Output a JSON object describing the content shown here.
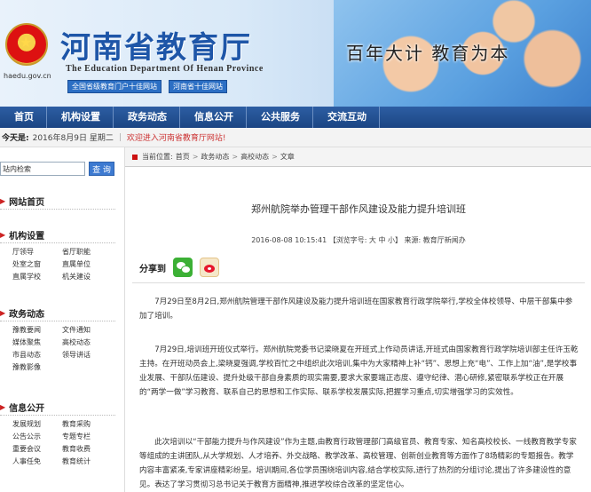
{
  "header": {
    "domain": "haedu.gov.cn",
    "title": "河南省教育厅",
    "title_en": "The Education Department Of Henan Province",
    "badges": [
      "全国省级教育门户十佳网站",
      "河南省十佳网站"
    ],
    "slogan": "百年大计 教育为本"
  },
  "nav": {
    "items": [
      "首页",
      "机构设置",
      "政务动态",
      "信息公开",
      "公共服务",
      "交流互动"
    ]
  },
  "datebar": {
    "label": "今天是:",
    "date": "2016年8月9日 星期二",
    "welcome": "欢迎进入河南省教育厅网站!"
  },
  "sidebar": {
    "search": {
      "value": "站内检索",
      "button": "查 询"
    },
    "sections": [
      {
        "title": "网站首页",
        "items": []
      },
      {
        "title": "机构设置",
        "items": [
          "厅领导",
          "省厅职能",
          "处室之窗",
          "直属单位",
          "直属学校",
          "机关建设"
        ]
      },
      {
        "title": "政务动态",
        "items": [
          "豫教要闻",
          "文件通知",
          "媒体聚焦",
          "高校动态",
          "市县动态",
          "领导讲话",
          "豫教影像"
        ]
      },
      {
        "title": "信息公开",
        "items": [
          "发展规划",
          "教育采购",
          "公告公示",
          "专题专栏",
          "重要会议",
          "教育收费",
          "人事任免",
          "教育统计"
        ]
      }
    ]
  },
  "article": {
    "breadcrumb": [
      "当前位置:",
      "首页",
      "政务动态",
      "高校动态",
      "文章"
    ],
    "title": "郑州航院举办管理干部作风建设及能力提升培训班",
    "meta": "2016-08-08 10:15:41 【浏览字号: 大 中 小】 来源: 教育厅新闻办",
    "share_label": "分享到",
    "paragraphs": [
      "7月29日至8月2日,郑州航院管理干部作风建设及能力提升培训班在国家教育行政学院举行,学校全体校领导、中层干部集中参加了培训。",
      "7月29日,培训班开班仪式举行。郑州航院党委书记梁晓夏在开班式上作动员讲话,开班式由国家教育行政学院培训部主任许玉乾主持。在开班动员会上,梁晓夏强调,学校百忙之中组织此次培训,集中为大家精神上补“钙”、思想上充“电”、工作上加“油”,是学校事业发展、干部队伍建设、提升处级干部自身素质的现实需要,要求大家要端正态度、遵守纪律、潜心研修,紧密联系学校正在开展的“两学一做”学习教育、联系自己的思想和工作实际、联系学校发展实际,把握学习重点,切实增强学习的实效性。",
      "此次培训以“干部能力提升与作风建设”作为主题,由教育行政管理部门高级官员、教育专家、知名高校校长、一线教育教学专家等组成的主讲团队,从大学规划、人才培养、外交战略、教学改革、高校管理、创新创业教育等方面作了8场精彩的专题报告。教学内容丰富紧凑,专家讲座精彩纷呈。培训期间,各位学员围绕培训内容,结合学校实际,进行了热烈的分组讨论,提出了许多建设性的意见。表达了学习贯彻习总书记关于教育方面精神,推进学校综合改革的坚定信心。"
    ]
  }
}
